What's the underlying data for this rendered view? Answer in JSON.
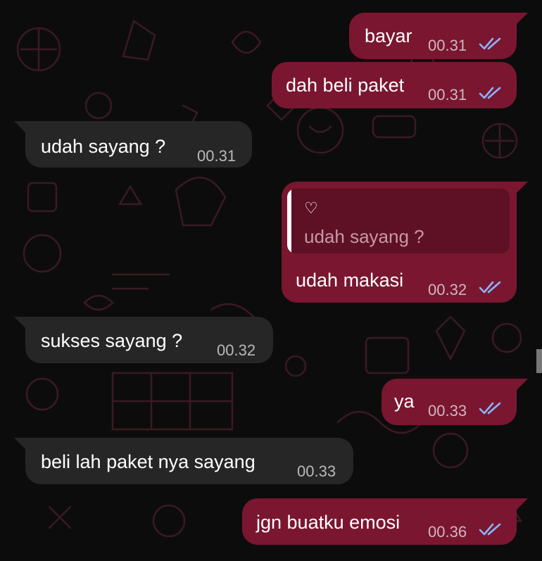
{
  "colors": {
    "outgoing_bubble": "#7a1630",
    "incoming_bubble": "#262626",
    "read_ticks": "#8ab4ff",
    "background": "#0c0c0c"
  },
  "messages": [
    {
      "direction": "outgoing",
      "text": "bayar",
      "time": "00.31",
      "status": "read-double-check-icon"
    },
    {
      "direction": "outgoing",
      "text": "dah beli paket",
      "time": "00.31",
      "status": "read-double-check-icon"
    },
    {
      "direction": "incoming",
      "text": "udah sayang ?",
      "time": "00.31"
    },
    {
      "direction": "outgoing",
      "reply_to": {
        "author": "♡",
        "text": "udah sayang ?"
      },
      "text": "udah makasi",
      "time": "00.32",
      "status": "read-double-check-icon"
    },
    {
      "direction": "incoming",
      "text": "sukses sayang ?",
      "time": "00.32"
    },
    {
      "direction": "outgoing",
      "text": "ya",
      "time": "00.33",
      "status": "read-double-check-icon"
    },
    {
      "direction": "incoming",
      "text": "beli lah paket nya sayang",
      "time": "00.33"
    },
    {
      "direction": "outgoing",
      "text": "jgn buatku emosi",
      "time": "00.36",
      "status": "read-double-check-icon"
    }
  ]
}
